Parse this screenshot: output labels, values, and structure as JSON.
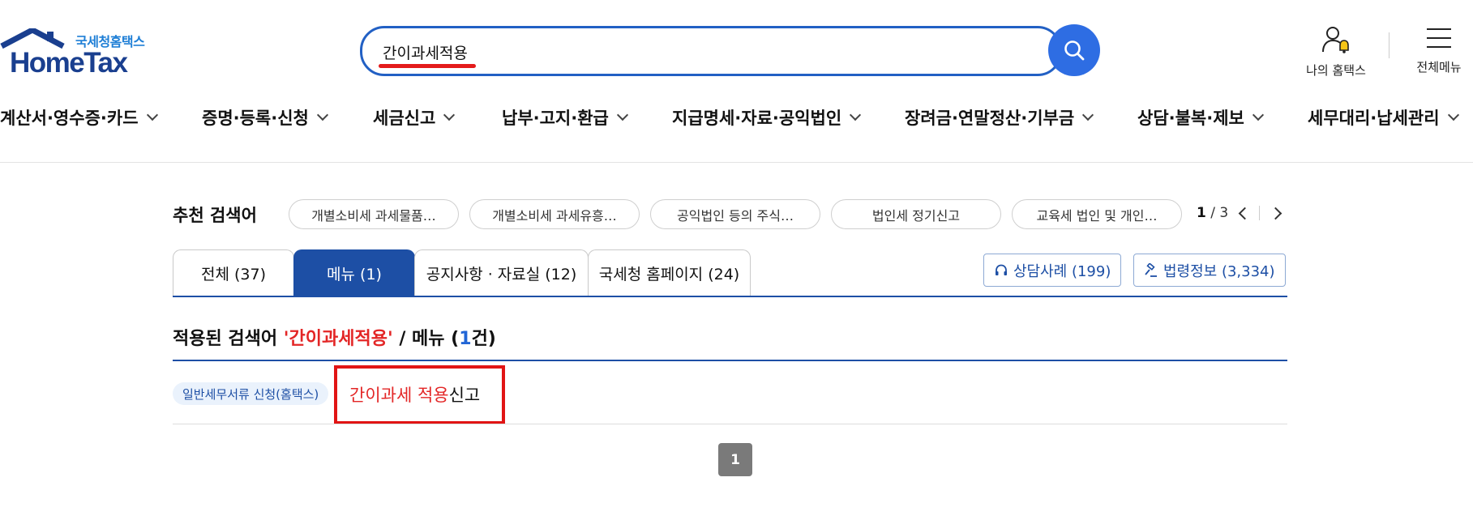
{
  "header": {
    "logo_sub": "국세청홈택스",
    "logo_main": "HomeTax",
    "search_value": "간이과세적용",
    "my_hometax_label": "나의 홈택스",
    "all_menu_label": "전체메뉴"
  },
  "nav": {
    "items": [
      "계산서·영수증·카드",
      "증명·등록·신청",
      "세금신고",
      "납부·고지·환급",
      "지급명세·자료·공익법인",
      "장려금·연말정산·기부금",
      "상담·불복·제보",
      "세무대리·납세관리"
    ]
  },
  "recommend": {
    "title": "추천 검색어",
    "chips": [
      "개별소비세 과세물품…",
      "개별소비세 과세유흥…",
      "공익법인 등의 주식…",
      "법인세 정기신고",
      "교육세 법인 및 개인…"
    ],
    "page_current": "1",
    "page_total": "/ 3"
  },
  "tabs": [
    "전체 (37)",
    "메뉴 (1)",
    "공지사항 · 자료실 (12)",
    "국세청 홈페이지 (24)"
  ],
  "side_buttons": {
    "consult": "상담사례 (199)",
    "law": "법령정보 (3,334)"
  },
  "result": {
    "prefix": "적용된 검색어 ",
    "keyword": "'간이과세적용'",
    "middle": " / 메뉴 (",
    "count": "1",
    "suffix": "건)",
    "category": "일반세무서류 신청(홈택스)",
    "link_highlight": "간이과세 적용",
    "link_rest": "신고"
  },
  "pagination": {
    "current": "1"
  },
  "colors": {
    "brand_blue": "#1d4fa5",
    "search_btn": "#2e6de3",
    "highlight_red": "#e32626"
  }
}
